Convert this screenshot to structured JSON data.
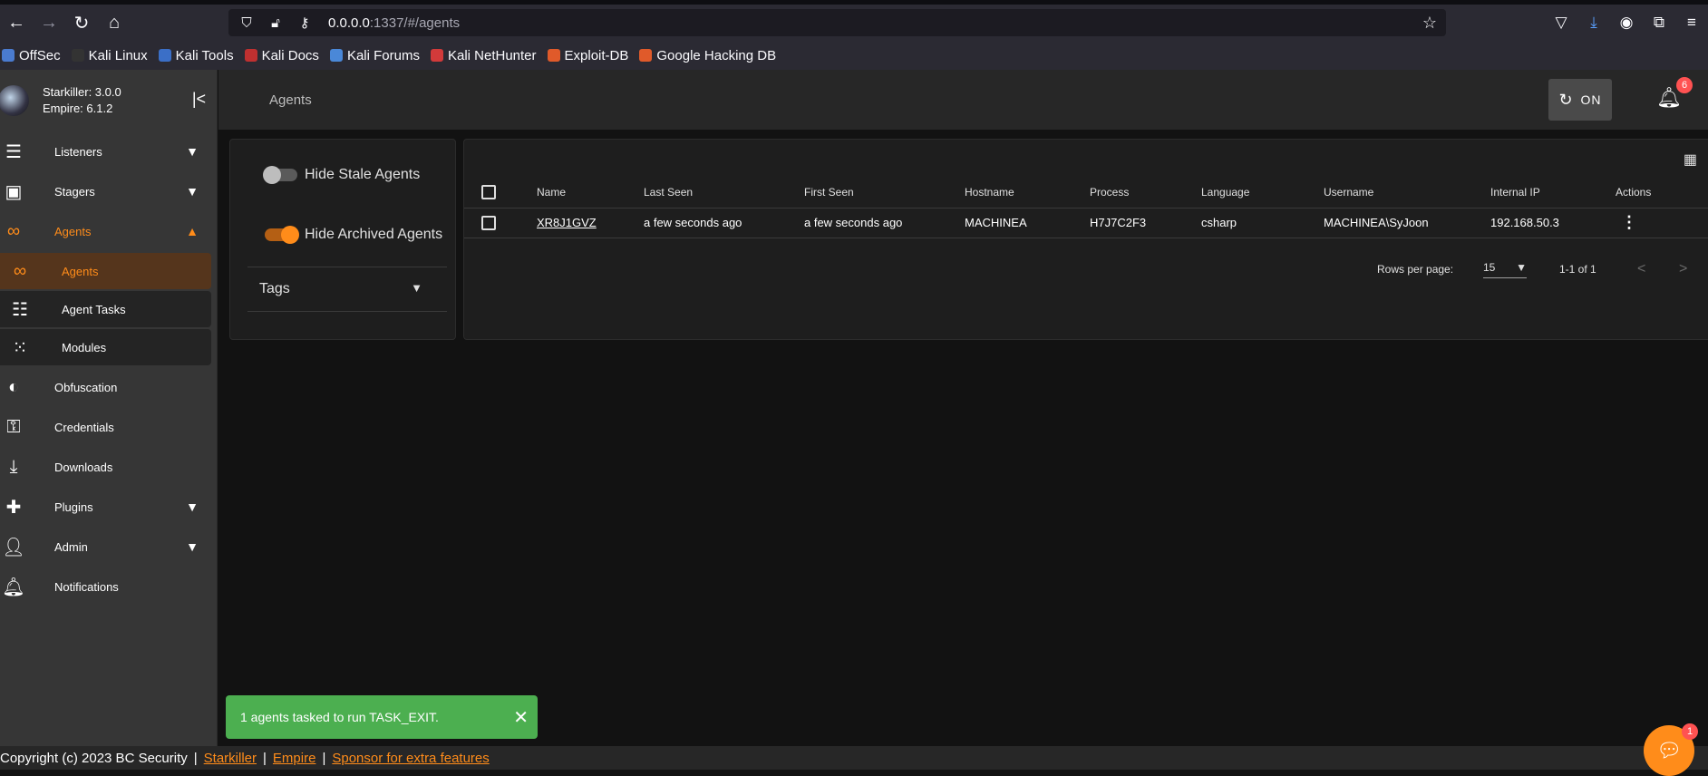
{
  "browser": {
    "url_host": "0.0.0.0",
    "url_path": ":1337/#/agents",
    "bookmarks": [
      "OffSec",
      "Kali Linux",
      "Kali Tools",
      "Kali Docs",
      "Kali Forums",
      "Kali NetHunter",
      "Exploit-DB",
      "Google Hacking DB"
    ],
    "bookmark_colors": [
      "#4a7bd0",
      "#333333",
      "#3b6fc7",
      "#c03030",
      "#4a88d8",
      "#d23a3a",
      "#e05a2a",
      "#e05a2a"
    ]
  },
  "sidebar": {
    "brand_line1": "Starkiller: 3.0.0",
    "brand_line2": "Empire: 6.1.2",
    "items": {
      "listeners": "Listeners",
      "stagers": "Stagers",
      "agents": "Agents",
      "agents_sub": "Agents",
      "agent_tasks": "Agent Tasks",
      "modules": "Modules",
      "obfuscation": "Obfuscation",
      "credentials": "Credentials",
      "downloads": "Downloads",
      "plugins": "Plugins",
      "admin": "Admin",
      "notifications": "Notifications"
    }
  },
  "header": {
    "title": "Agents",
    "on_label": "ON",
    "notification_count": "6"
  },
  "filters": {
    "hide_stale": "Hide Stale Agents",
    "hide_stale_on": false,
    "hide_archived": "Hide Archived Agents",
    "hide_archived_on": true,
    "tags": "Tags"
  },
  "table": {
    "headers": {
      "name": "Name",
      "last_seen": "Last Seen",
      "first_seen": "First Seen",
      "hostname": "Hostname",
      "process": "Process",
      "language": "Language",
      "username": "Username",
      "internal_ip": "Internal IP",
      "actions": "Actions"
    },
    "rows": [
      {
        "name": "XR8J1GVZ",
        "last_seen": "a few seconds ago",
        "first_seen": "a few seconds ago",
        "hostname": "MACHINEA",
        "process": "H7J7C2F3",
        "language": "csharp",
        "username": "MACHINEA\\SyJoon",
        "internal_ip": "192.168.50.3"
      }
    ],
    "rows_per_page_label": "Rows per page:",
    "rows_per_page": "15",
    "range": "1-1 of 1"
  },
  "snackbar": {
    "message": "1 agents tasked to run TASK_EXIT."
  },
  "footer": {
    "copyright": "Copyright (c) 2023 BC Security",
    "link1": "Starkiller",
    "link2": "Empire",
    "link3": "Sponsor for extra features"
  },
  "chat_badge": "1",
  "colors": {
    "accent": "#ff8c1a",
    "snackbar": "#4caf50",
    "badge": "#ff5252"
  }
}
